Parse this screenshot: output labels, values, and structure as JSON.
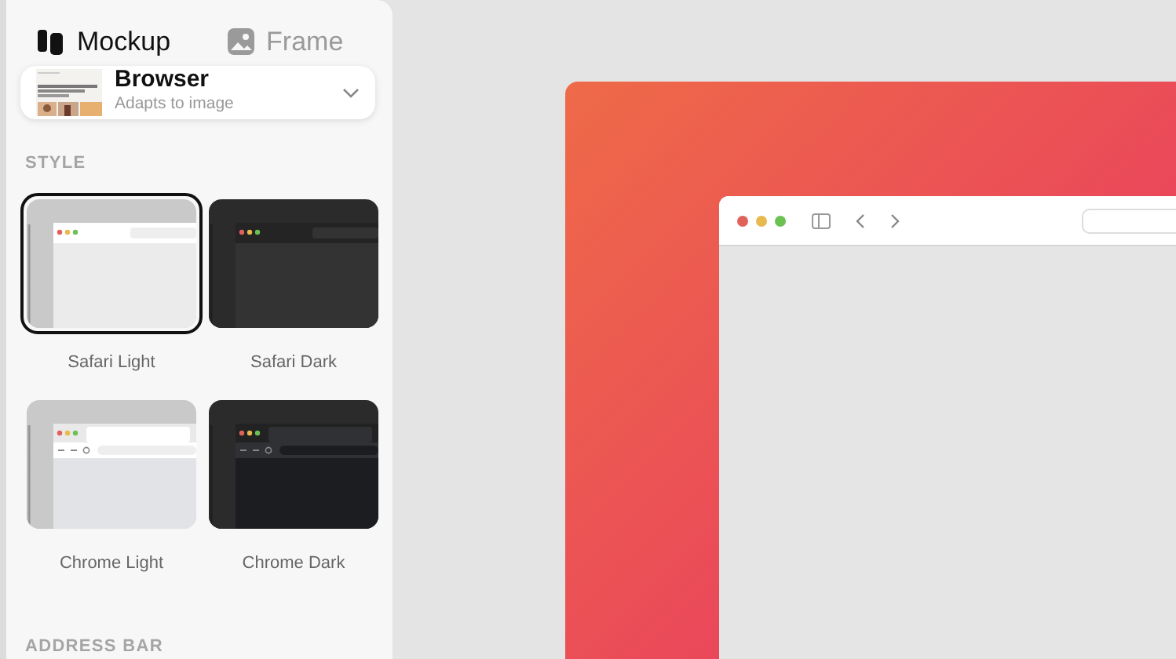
{
  "tabs": [
    {
      "label": "Mockup",
      "selected": true
    },
    {
      "label": "Frame",
      "selected": false
    }
  ],
  "device_picker": {
    "title": "Browser",
    "subtitle": "Adapts to image"
  },
  "style_section": {
    "heading": "STYLE",
    "styles": [
      {
        "label": "Safari Light",
        "kind": "safari-light",
        "selected": true
      },
      {
        "label": "Safari Dark",
        "kind": "safari-dark",
        "selected": false
      },
      {
        "label": "Chrome Light",
        "kind": "chrome-light",
        "selected": false
      },
      {
        "label": "Chrome Dark",
        "kind": "chrome-dark",
        "selected": false
      }
    ]
  },
  "address_bar_section": {
    "heading": "ADDRESS BAR"
  }
}
